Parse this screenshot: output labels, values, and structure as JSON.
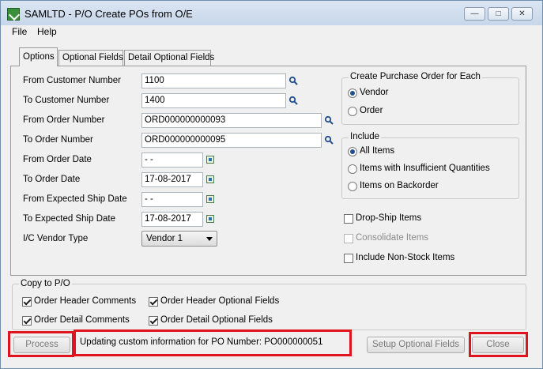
{
  "window": {
    "title": "SAMLTD  -  P/O Create POs from O/E"
  },
  "menu": {
    "file": "File",
    "help": "Help"
  },
  "tabs": [
    "Options",
    "Optional Fields",
    "Detail Optional Fields"
  ],
  "options": {
    "from_customer_label": "From Customer Number",
    "from_customer_value": "1100",
    "to_customer_label": "To Customer Number",
    "to_customer_value": "1400",
    "from_order_label": "From Order Number",
    "from_order_value": "ORD000000000093",
    "to_order_label": "To Order Number",
    "to_order_value": "ORD000000000095",
    "from_order_date_label": "From Order Date",
    "from_order_date_value": " - -",
    "to_order_date_label": "To Order Date",
    "to_order_date_value": "17-08-2017",
    "from_ship_date_label": "From Expected Ship Date",
    "from_ship_date_value": " - -",
    "to_ship_date_label": "To Expected Ship Date",
    "to_ship_date_value": "17-08-2017",
    "vendor_type_label": "I/C Vendor Type",
    "vendor_type_value": "Vendor 1"
  },
  "create_po": {
    "title": "Create Purchase Order for Each",
    "vendor": "Vendor",
    "order": "Order"
  },
  "include": {
    "title": "Include",
    "all": "All Items",
    "insufficient": "Items with Insufficient Quantities",
    "backorder": "Items on Backorder"
  },
  "checks": {
    "drop_ship": "Drop-Ship Items",
    "consolidate": "Consolidate Items",
    "non_stock": "Include Non-Stock Items"
  },
  "copy": {
    "title": "Copy to P/O",
    "header_comments": "Order Header Comments",
    "detail_comments": "Order Detail Comments",
    "header_optional": "Order Header Optional Fields",
    "detail_optional": "Order Detail Optional Fields"
  },
  "footer": {
    "process": "Process",
    "status": "Updating custom information for PO Number: PO000000051",
    "setup_optional": "Setup Optional Fields",
    "close": "Close"
  },
  "colors": {
    "highlight": "#e0141e"
  }
}
